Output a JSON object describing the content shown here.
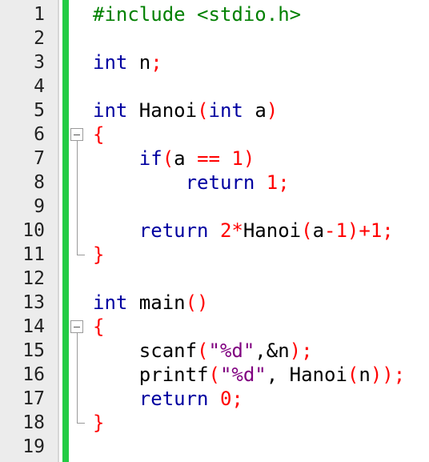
{
  "editor": {
    "colors": {
      "keyword": "#0000a0",
      "preprocessor": "#008000",
      "number": "#ff0000",
      "operator": "#ff0000",
      "string": "#800080",
      "change_bar": "#22cc44"
    },
    "lines": [
      {
        "number": "1",
        "tokens": [
          {
            "t": "#include <stdio.h>",
            "c": "pp"
          }
        ]
      },
      {
        "number": "2",
        "tokens": []
      },
      {
        "number": "3",
        "tokens": [
          {
            "t": "int",
            "c": "kw"
          },
          {
            "t": " n",
            "c": "plain"
          },
          {
            "t": ";",
            "c": "op"
          }
        ]
      },
      {
        "number": "4",
        "tokens": []
      },
      {
        "number": "5",
        "tokens": [
          {
            "t": "int",
            "c": "kw"
          },
          {
            "t": " Hanoi",
            "c": "plain"
          },
          {
            "t": "(",
            "c": "br"
          },
          {
            "t": "int",
            "c": "kw"
          },
          {
            "t": " a",
            "c": "plain"
          },
          {
            "t": ")",
            "c": "br"
          }
        ]
      },
      {
        "number": "6",
        "tokens": [
          {
            "t": "{",
            "c": "br"
          }
        ],
        "fold": "start"
      },
      {
        "number": "7",
        "tokens": [
          {
            "t": "    if",
            "c": "kw"
          },
          {
            "t": "(",
            "c": "br"
          },
          {
            "t": "a ",
            "c": "plain"
          },
          {
            "t": "==",
            "c": "op"
          },
          {
            "t": " ",
            "c": "plain"
          },
          {
            "t": "1",
            "c": "num"
          },
          {
            "t": ")",
            "c": "br"
          }
        ],
        "fold": "mid"
      },
      {
        "number": "8",
        "tokens": [
          {
            "t": "        return",
            "c": "kw"
          },
          {
            "t": " ",
            "c": "plain"
          },
          {
            "t": "1",
            "c": "num"
          },
          {
            "t": ";",
            "c": "op"
          }
        ],
        "fold": "mid"
      },
      {
        "number": "9",
        "tokens": [],
        "fold": "mid"
      },
      {
        "number": "10",
        "tokens": [
          {
            "t": "    return",
            "c": "kw"
          },
          {
            "t": " ",
            "c": "plain"
          },
          {
            "t": "2",
            "c": "num"
          },
          {
            "t": "*",
            "c": "op"
          },
          {
            "t": "Hanoi",
            "c": "plain"
          },
          {
            "t": "(",
            "c": "br"
          },
          {
            "t": "a",
            "c": "plain"
          },
          {
            "t": "-",
            "c": "op"
          },
          {
            "t": "1",
            "c": "num"
          },
          {
            "t": ")",
            "c": "br"
          },
          {
            "t": "+",
            "c": "op"
          },
          {
            "t": "1",
            "c": "num"
          },
          {
            "t": ";",
            "c": "op"
          }
        ],
        "fold": "mid"
      },
      {
        "number": "11",
        "tokens": [
          {
            "t": "}",
            "c": "br"
          }
        ],
        "fold": "end"
      },
      {
        "number": "12",
        "tokens": []
      },
      {
        "number": "13",
        "tokens": [
          {
            "t": "int",
            "c": "kw"
          },
          {
            "t": " main",
            "c": "plain"
          },
          {
            "t": "()",
            "c": "br"
          }
        ]
      },
      {
        "number": "14",
        "tokens": [
          {
            "t": "{",
            "c": "br"
          }
        ],
        "fold": "start"
      },
      {
        "number": "15",
        "tokens": [
          {
            "t": "    scanf",
            "c": "plain"
          },
          {
            "t": "(",
            "c": "br"
          },
          {
            "t": "\"%d\"",
            "c": "str"
          },
          {
            "t": ",&n",
            "c": "plain"
          },
          {
            "t": ")",
            "c": "br"
          },
          {
            "t": ";",
            "c": "op"
          }
        ],
        "fold": "mid"
      },
      {
        "number": "16",
        "tokens": [
          {
            "t": "    printf",
            "c": "plain"
          },
          {
            "t": "(",
            "c": "br"
          },
          {
            "t": "\"%d\"",
            "c": "str"
          },
          {
            "t": ", Hanoi",
            "c": "plain"
          },
          {
            "t": "(",
            "c": "br"
          },
          {
            "t": "n",
            "c": "plain"
          },
          {
            "t": "))",
            "c": "br"
          },
          {
            "t": ";",
            "c": "op"
          }
        ],
        "fold": "mid"
      },
      {
        "number": "17",
        "tokens": [
          {
            "t": "    return",
            "c": "kw"
          },
          {
            "t": " ",
            "c": "plain"
          },
          {
            "t": "0",
            "c": "num"
          },
          {
            "t": ";",
            "c": "op"
          }
        ],
        "fold": "mid"
      },
      {
        "number": "18",
        "tokens": [
          {
            "t": "}",
            "c": "br"
          }
        ],
        "fold": "end"
      },
      {
        "number": "19",
        "tokens": []
      }
    ]
  }
}
